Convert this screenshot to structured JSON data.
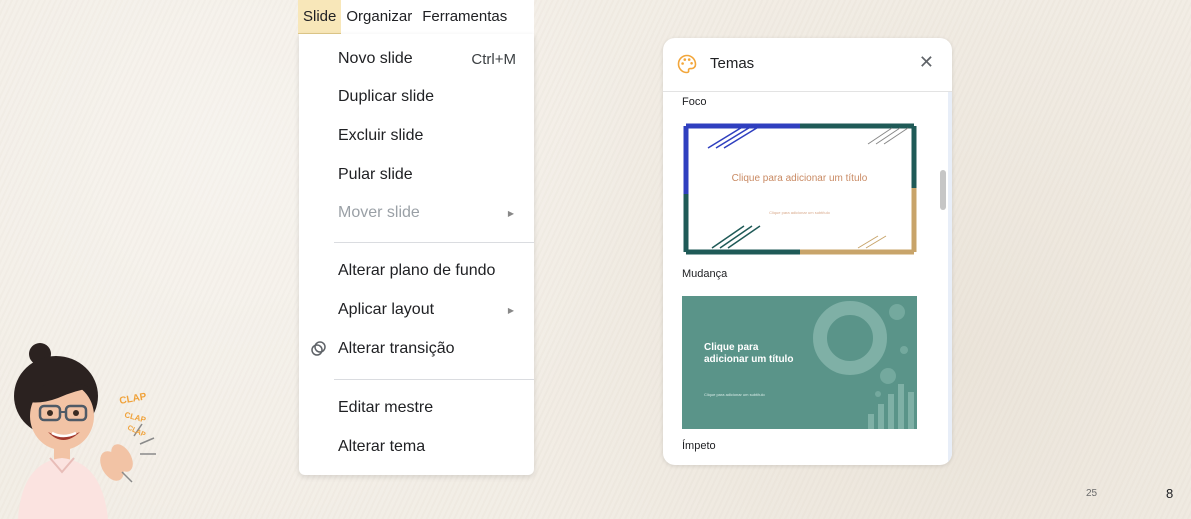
{
  "menubar": {
    "items": [
      {
        "label": "Slide",
        "active": true
      },
      {
        "label": "Organizar",
        "active": false
      },
      {
        "label": "Ferramentas",
        "active": false
      }
    ]
  },
  "slide_menu": {
    "items": [
      {
        "label": "Novo slide",
        "shortcut": "Ctrl+M"
      },
      {
        "label": "Duplicar slide"
      },
      {
        "label": "Excluir slide"
      },
      {
        "label": "Pular slide"
      },
      {
        "label": "Mover slide",
        "disabled": true,
        "submenu": true
      },
      {
        "label": "Alterar plano de fundo"
      },
      {
        "label": "Aplicar layout",
        "submenu": true
      },
      {
        "label": "Alterar transição",
        "icon": "transition-icon"
      },
      {
        "label": "Editar mestre"
      },
      {
        "label": "Alterar tema"
      }
    ]
  },
  "themes_panel": {
    "title": "Temas",
    "close_icon": "close-icon",
    "header_icon": "palette-icon",
    "themes": [
      {
        "name": "Foco",
        "preview_title": "Clique para adicionar um título",
        "preview_subtitle": "Clique para adicionar um subtítulo"
      },
      {
        "name": "Mudança",
        "preview_title": "Clique para adicionar um título",
        "preview_subtitle": "Clique para adicionar um subtítulo"
      },
      {
        "name": "Ímpeto"
      }
    ],
    "colors": {
      "foco_blue": "#2f3fbf",
      "foco_teal": "#1f5a57",
      "foco_gold": "#c8a46a",
      "mudanca_bg": "#5a9489"
    }
  },
  "footer": {
    "page_number": "25",
    "slide_number": "8"
  },
  "decoration": {
    "sticker_text_lines": [
      "CLAP",
      "CLAP",
      "CLAP"
    ]
  },
  "colors": {
    "menu_active": "#f8e7b9",
    "background": "#f2ede5"
  }
}
